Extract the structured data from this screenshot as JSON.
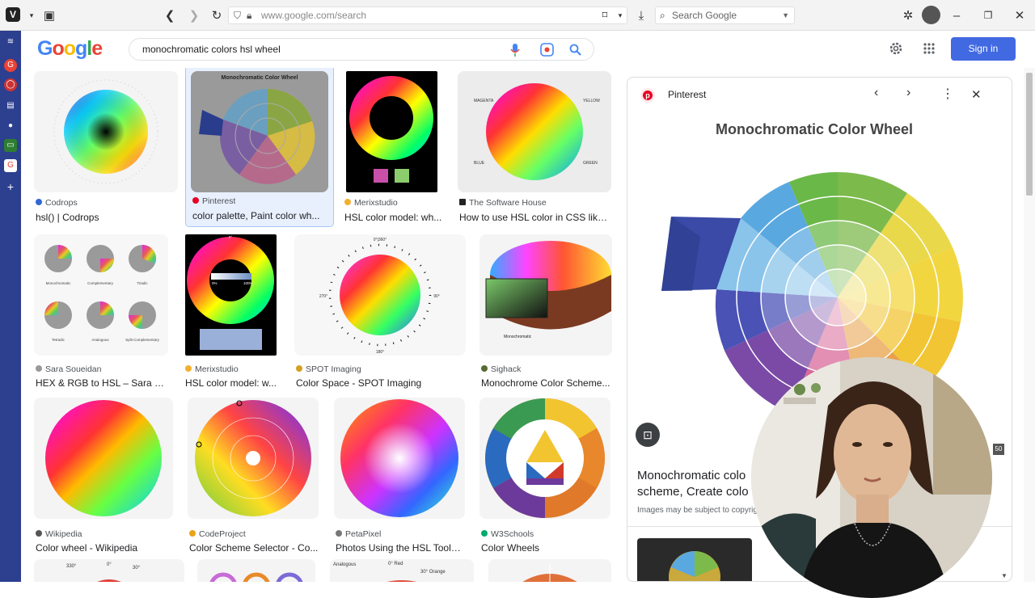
{
  "browser": {
    "url_text": "www.google.com/search",
    "search_placeholder": "Search Google"
  },
  "google": {
    "logo_text": "Google",
    "query": "monochromatic colors hsl wheel",
    "sign_in_label": "Sign in"
  },
  "results": [
    {
      "source": "Codrops",
      "caption": "hsl() | Codrops",
      "fav_color": "#3367d6"
    },
    {
      "source": "Pinterest",
      "caption": "color palette, Paint color wh...",
      "fav_color": "#e60023"
    },
    {
      "source": "Merixstudio",
      "caption": "HSL color model: wh...",
      "fav_color": "#f0b030"
    },
    {
      "source": "The Software House",
      "caption": "How to use HSL color in CSS like ...",
      "fav_color": "#222222"
    },
    {
      "source": "Sara Soueidan",
      "caption": "HEX & RGB to HSL – Sara S...",
      "fav_color": "#999999"
    },
    {
      "source": "Merixstudio",
      "caption": "HSL color model: w...",
      "fav_color": "#f0b030"
    },
    {
      "source": "SPOT Imaging",
      "caption": "Color Space - SPOT Imaging",
      "fav_color": "#d4a020"
    },
    {
      "source": "Sighack",
      "caption": "Monochrome Color Scheme...",
      "fav_color": "#556b2f"
    },
    {
      "source": "Wikipedia",
      "caption": "Color wheel - Wikipedia",
      "fav_color": "#555555"
    },
    {
      "source": "CodeProject",
      "caption": "Color Scheme Selector - Co...",
      "fav_color": "#e8a317"
    },
    {
      "source": "PetaPixel",
      "caption": "Photos Using the HSL Tool i...",
      "fav_color": "#777777"
    },
    {
      "source": "W3Schools",
      "caption": "Color Wheels",
      "fav_color": "#04aa6d"
    }
  ],
  "thumb_text": {
    "pinterest_title": "Monochromatic Color Wheel",
    "sighack_label": "Monochromatic",
    "merix_label_0": "0°",
    "merix_label_100": "100%",
    "merix_label_0pct": "0%",
    "spot_top": "0°|360°",
    "spot_right": "90°",
    "spot_bottom": "180°",
    "spot_left": "270°",
    "tsh_magenta": "MAGENTA",
    "tsh_yellow": "YELLOW",
    "tsh_blue": "BLUE",
    "tsh_green": "GREEN",
    "sara_labels": [
      "Monochromatic",
      "Complementary",
      "Triadic",
      "Tetradic",
      "Analogous",
      "Split Complementary"
    ],
    "bottom_row": [
      "330°",
      "0°",
      "30°",
      "Analogous",
      "0° Red",
      "30° Orange"
    ]
  },
  "preview": {
    "source": "Pinterest",
    "image_title": "Monochromatic Color Wheel",
    "title_line1": "Monochromatic colo",
    "title_line2": "scheme, Create colo",
    "notice": "Images may be subject to copyrig",
    "counter": "50"
  }
}
